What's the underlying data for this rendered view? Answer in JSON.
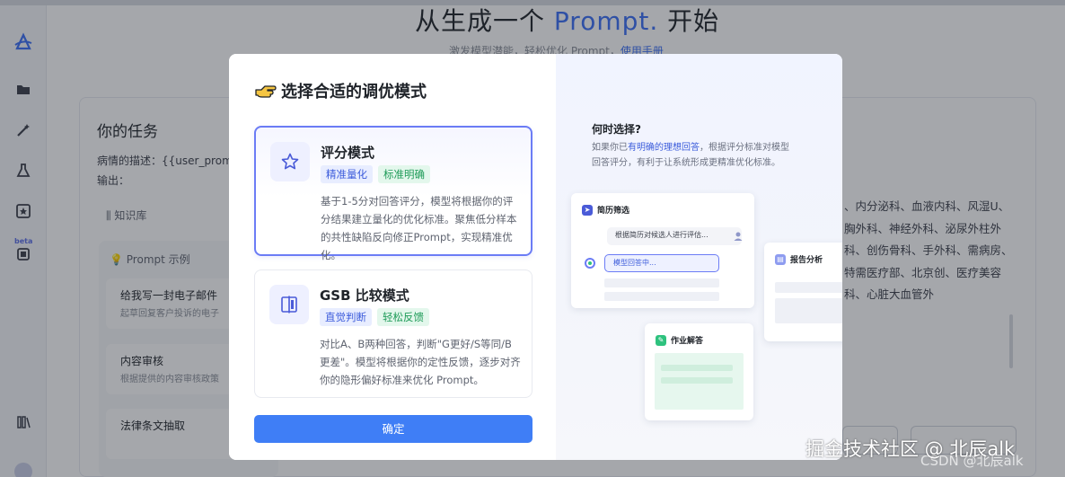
{
  "background": {
    "title_prefix": "从生成一个 ",
    "title_accent": "Prompt.",
    "title_suffix": " 开始",
    "subtitle": "激发模型潜能，轻松优化 Prompt，",
    "subtitle_link": "使用手册",
    "task_title": "你的任务",
    "task_desc": "病情的描述：{{user_prom",
    "task_output": "输出：",
    "knowledge_base": "知识库",
    "examples_header": "Prompt 示例",
    "examples": [
      {
        "title": "给我写一封电子邮件",
        "desc": "起草回复客户投诉的电子"
      },
      {
        "title": "内容审核",
        "desc": "根据提供的内容审核政策"
      },
      {
        "title": "法律条文抽取",
        "desc": ""
      }
    ],
    "right_text": "、内分泌科、血液内科、风湿U、胸外科、神经外科、泌尿外柱外科、创伤骨科、手外科、需病房、特需医疗部、北京创、医疗美容科、心脏大血管外"
  },
  "modal": {
    "title": "选择合适的调优模式",
    "modes": [
      {
        "title": "评分模式",
        "tags": [
          "精准量化",
          "标准明确"
        ],
        "desc": "基于1-5分对回答评分，模型将根据你的评分结果建立量化的优化标准。聚焦低分样本的共性缺陷反向修正Prompt，实现精准优化。",
        "selected": true
      },
      {
        "title": "GSB 比较模式",
        "tags": [
          "直觉判断",
          "轻松反馈"
        ],
        "desc": "对比A、B两种回答，判断\"G更好/S等同/B更差\"。模型将根据你的定性反馈，逐步对齐你的隐形偏好标准来优化 Prompt。",
        "selected": false
      }
    ],
    "confirm_label": "确定",
    "when_title": "何时选择?",
    "when_desc_pre": "如果你已",
    "when_desc_highlight": "有明确的理想回答",
    "when_desc_post": "，根据评分标准对模型回答评分，有利于让系统形成更精准优化标准。",
    "illustration": {
      "card1_title": "简历筛选",
      "card1_bubble1": "根据简历对候选人进行评估...",
      "card1_bubble2": "模型回答中...",
      "card2_title": "报告分析",
      "card3_title": "作业解答"
    }
  },
  "watermark": {
    "main": "掘金技术社区 @ 北辰alk",
    "sub": "CSDN @北辰alk"
  },
  "colors": {
    "primary": "#3f7ef6",
    "accent_blue": "#3b6ff5",
    "selected_border": "#6b7cf5",
    "tag_blue_bg": "#e8edff",
    "tag_green_bg": "#e3f7ec"
  }
}
